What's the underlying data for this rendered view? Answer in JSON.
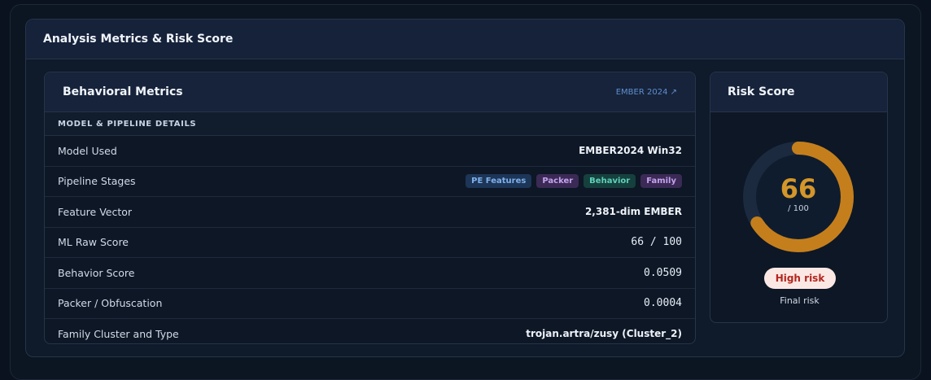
{
  "panel": {
    "title": "Analysis Metrics & Risk Score"
  },
  "metrics": {
    "title": "Behavioral Metrics",
    "link": "EMBER 2024 ↗",
    "section": "MODEL & PIPELINE DETAILS",
    "rows": [
      {
        "label": "Model Used",
        "value": "EMBER2024 Win32"
      },
      {
        "label": "Pipeline Stages",
        "tags": [
          "PE Features",
          "Packer",
          "Behavior",
          "Family"
        ]
      },
      {
        "label": "Feature Vector",
        "value": "2,381-dim EMBER"
      },
      {
        "label": "ML Raw Score",
        "value": "66 / 100"
      },
      {
        "label": "Behavior Score",
        "value": "0.0509"
      },
      {
        "label": "Packer / Obfuscation",
        "value": "0.0004"
      },
      {
        "label": "Family Cluster and Type",
        "value": "trojan.artra/zusy (Cluster_2)"
      }
    ]
  },
  "risk": {
    "title": "Risk Score",
    "score": "66",
    "max": "/ 100",
    "score_fraction": 0.66,
    "badge": "High risk",
    "caption": "Final risk",
    "colors": {
      "arc": "#c47f1c",
      "track": "#1c2a40",
      "badge_bg": "#fbe8e4",
      "badge_text": "#b3261e"
    }
  }
}
